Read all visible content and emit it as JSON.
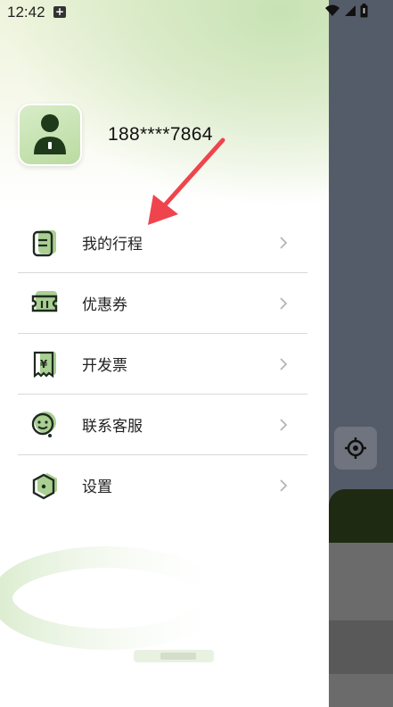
{
  "status_bar": {
    "time": "12:42",
    "notification_icon": "plus-box-icon"
  },
  "profile": {
    "phone": "188****7864"
  },
  "menu": [
    {
      "label": "我的行程",
      "icon": "trip-document-icon"
    },
    {
      "label": "优惠券",
      "icon": "coupon-ticket-icon"
    },
    {
      "label": "开发票",
      "icon": "invoice-receipt-icon"
    },
    {
      "label": "联系客服",
      "icon": "customer-service-icon"
    },
    {
      "label": "设置",
      "icon": "settings-hexagon-icon"
    }
  ],
  "colors": {
    "accent_green": "#7fb36a",
    "icon_dark": "#1f2a1f",
    "divider": "#d9d9d9",
    "map_bg": "#555c69"
  }
}
